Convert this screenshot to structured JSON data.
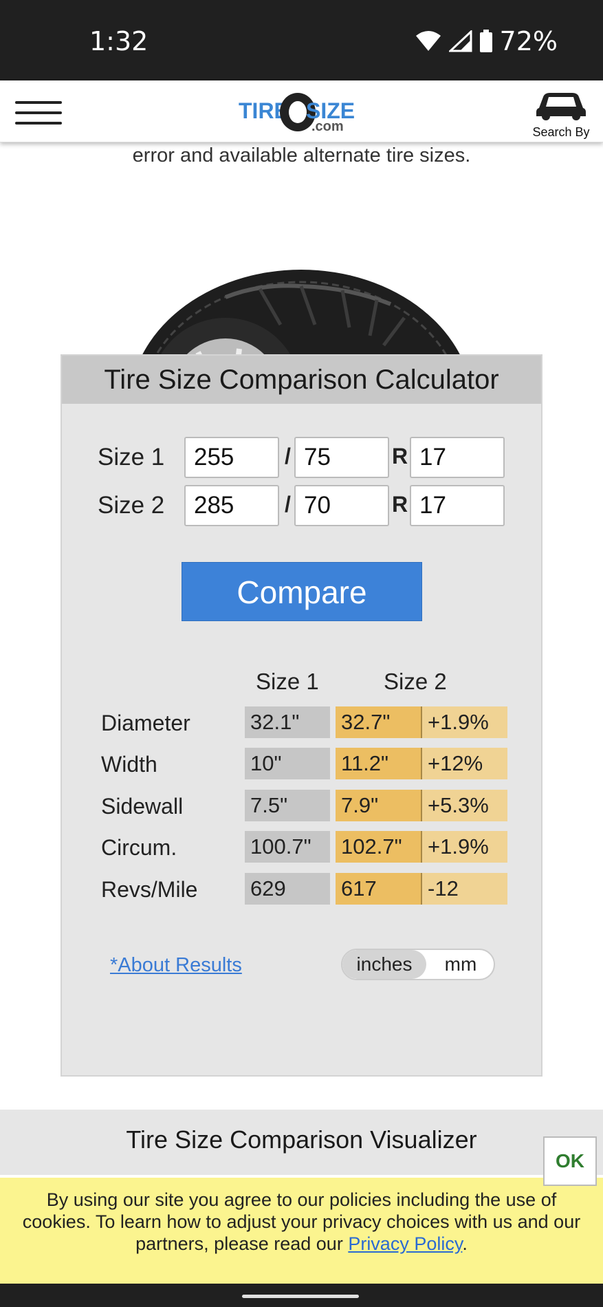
{
  "status_bar": {
    "time": "1:32",
    "battery": "72%",
    "icons": [
      "wifi-icon",
      "signal-icon",
      "battery-icon"
    ]
  },
  "header": {
    "logo": {
      "word1": "TIRE",
      "word2": "SIZE",
      "suffix": ".com"
    },
    "search_by_label": "Search By",
    "icons": [
      "hamburger-menu-icon",
      "car-icon"
    ]
  },
  "intro_text": "error and available alternate tire sizes.",
  "calculator": {
    "title": "Tire Size Comparison Calculator",
    "size1": {
      "label": "Size 1",
      "width": "255",
      "aspect": "75",
      "rim": "17"
    },
    "size2": {
      "label": "Size 2",
      "width": "285",
      "aspect": "70",
      "rim": "17"
    },
    "separator": "/",
    "rim_prefix": "R",
    "compare_label": "Compare",
    "col_size1": "Size 1",
    "col_size2": "Size 2",
    "rows": [
      {
        "label": "Diameter",
        "size1": "32.1\"",
        "size2": "32.7\"",
        "diff": "+1.9%"
      },
      {
        "label": "Width",
        "size1": "10\"",
        "size2": "11.2\"",
        "diff": "+12%"
      },
      {
        "label": "Sidewall",
        "size1": "7.5\"",
        "size2": "7.9\"",
        "diff": "+5.3%"
      },
      {
        "label": "Circum.",
        "size1": "100.7\"",
        "size2": "102.7\"",
        "diff": "+1.9%"
      },
      {
        "label": "Revs/Mile",
        "size1": "629",
        "size2": "617",
        "diff": "-12"
      }
    ],
    "about_link": "*About Results",
    "units": {
      "selected": "inches",
      "other": "mm"
    }
  },
  "visualizer_title": "Tire Size Comparison Visualizer",
  "cookie_banner": {
    "text": "By using our site you agree to our policies including the use of cookies. To learn how to adjust your privacy choices with us and our partners, please read our ",
    "link": "Privacy Policy",
    "end": ".",
    "ok_label": "OK"
  },
  "colors": {
    "accent": "#3d82d8",
    "size2_cell": "#ecbe62",
    "diff_cell": "#f0d394",
    "size1_cell": "#c6c6c6",
    "banner": "#fbf48f"
  }
}
